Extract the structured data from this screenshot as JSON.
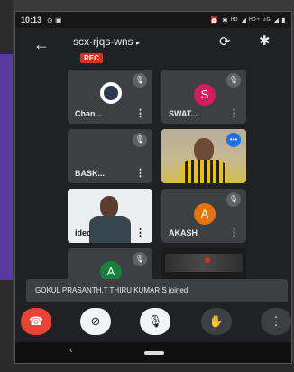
{
  "status": {
    "time": "10:13",
    "left_icons": "⊙ ▣",
    "right": "⏰ ✱ ᴴᴰ ◢ ᴴᴰ⁺ ⁴ᴳ ◢ ▮"
  },
  "meeting": {
    "title": "scx-rjqs-wns",
    "title_chevron": "▸",
    "rec_label": "REC"
  },
  "participants": [
    {
      "name": "Chan...",
      "avatar_letter": "",
      "more": "⋮"
    },
    {
      "name": "SWAT...",
      "avatar_letter": "S",
      "more": "⋮"
    },
    {
      "name": "BASK...",
      "avatar_letter": "",
      "more": "⋮"
    },
    {
      "name": "",
      "avatar_letter": "",
      "more": ""
    },
    {
      "name": "idec",
      "avatar_letter": "",
      "more": "⋮"
    },
    {
      "name": "AKASH",
      "avatar_letter": "A",
      "more": "⋮"
    },
    {
      "name": "",
      "avatar_letter": "A",
      "more": ""
    },
    {
      "name": "",
      "avatar_letter": "",
      "more": ""
    }
  ],
  "toast": {
    "text": "GOKUL PRASANTH.T THIRU KUMAR.S joined"
  },
  "controls": {
    "end": "☎",
    "camera": "⊘",
    "mic": "🎙",
    "hand": "✋",
    "more": "⋮"
  },
  "nav": {
    "back": "‹"
  },
  "colors": {
    "rec": "#d93025",
    "end_call": "#ea4335",
    "avatar_pink": "#d81b60",
    "avatar_orange": "#e8710a",
    "avatar_green": "#188038",
    "background_purple": "#5b3a9e"
  }
}
